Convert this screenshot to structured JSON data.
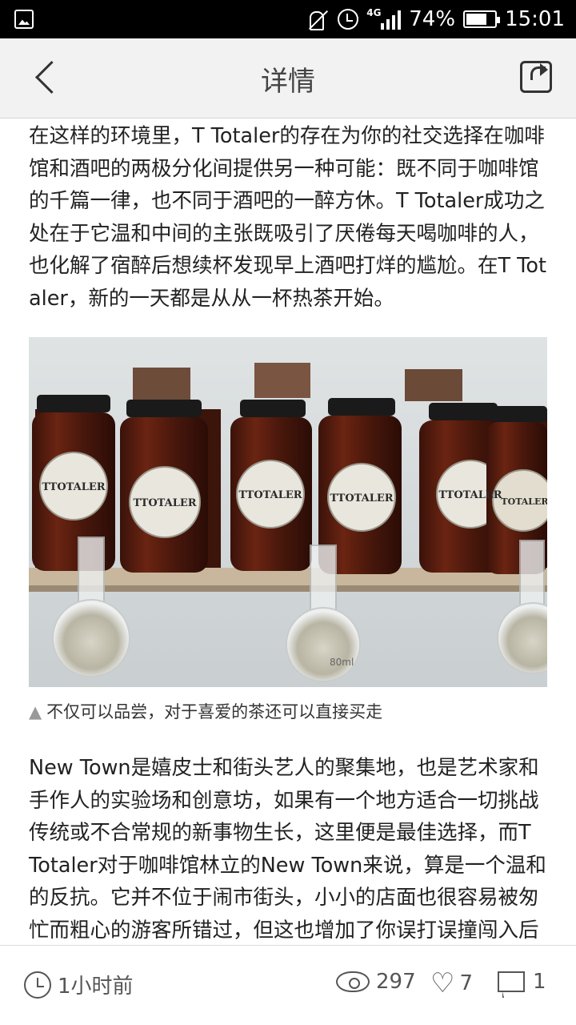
{
  "status_bar": {
    "network": "4G",
    "battery": "74%",
    "battery_level": 0.74,
    "time": "15:01",
    "icons": [
      "gallery-icon",
      "mute-icon",
      "alarm-icon",
      "signal-icon",
      "battery-icon"
    ]
  },
  "header": {
    "title": "详情",
    "back_icon": "chevron-left-icon",
    "share_icon": "share-icon"
  },
  "article": {
    "paragraph_1": "在这样的环境里，T Totaler的存在为你的社交选择在咖啡馆和酒吧的两极分化间提供另一种可能：既不同于咖啡馆的千篇一律，也不同于酒吧的一醉方休。T Totaler成功之处在于它温和中间的主张既吸引了厌倦每天喝咖啡的人，也化解了宿醉后想续杯发现早上酒吧打烊的尴尬。在T Totaler，新的一天都是从从一杯热茶开始。",
    "image_jar_labels": [
      "TTOTALER",
      "TTOTALER",
      "TTOTALER",
      "TTOTALER",
      "TTOTALER",
      "TOTALER"
    ],
    "flask_label": "80ml",
    "caption_marker": "▲",
    "caption": "不仅可以品尝，对于喜爱的茶还可以直接买走",
    "paragraph_2": "New Town是嬉皮士和街头艺人的聚集地，也是艺术家和手作人的实验场和创意坊，如果有一个地方适合一切挑战传统或不合常规的新事物生长，这里便是最佳选择，而T Totaler对于咖啡馆林立的New Town来说，算是一个温和的反抗。它并不位于闹市街头，小小的店面也很容易被匆忙而粗心的游客所错过，但这也增加了你误打误撞闯入后的惊喜，而对慕名而来的"
  },
  "footer": {
    "time_ago": "1小时前",
    "views": "297",
    "likes": "7",
    "comments": "1"
  }
}
